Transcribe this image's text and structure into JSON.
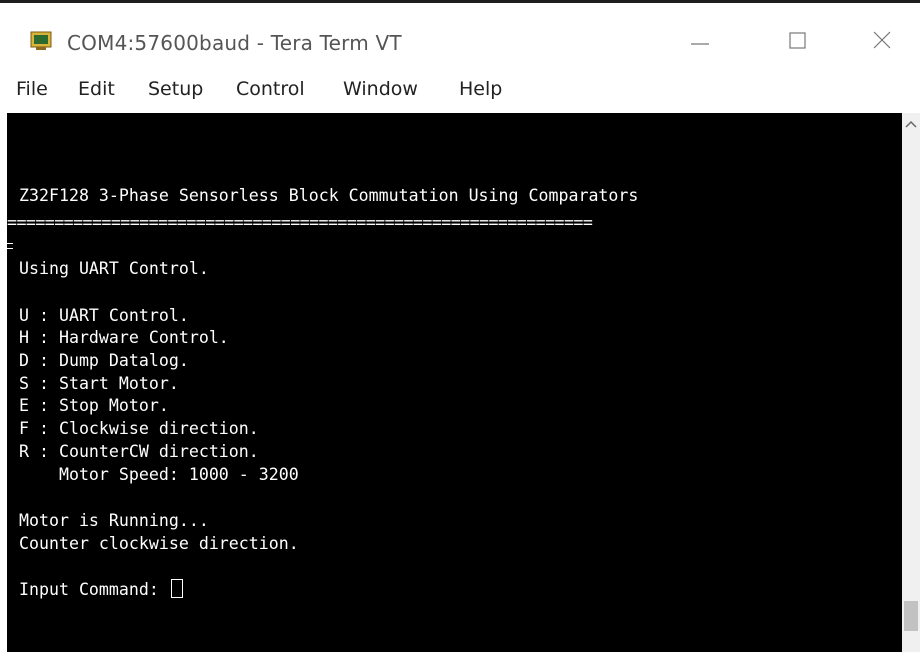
{
  "window": {
    "title": "COM4:57600baud - Tera Term VT"
  },
  "menu": {
    "items": [
      "File",
      "Edit",
      "Setup",
      "Control",
      "Window",
      "Help"
    ]
  },
  "terminal": {
    "header": "Z32F128 3-Phase Sensorless Block Commutation Using Comparators",
    "separator": "==============================================================",
    "mode": "Using UART Control.",
    "commands": [
      "U : UART Control.",
      "H : Hardware Control.",
      "D : Dump Datalog.",
      "S : Start Motor.",
      "E : Stop Motor.",
      "F : Clockwise direction.",
      "R : CounterCW direction.",
      "    Motor Speed: 1000 - 3200"
    ],
    "status1": "Motor is Running...",
    "status2": "Counter clockwise direction.",
    "prompt": "Input Command: "
  },
  "colors": {
    "terminal_bg": "#000000",
    "terminal_fg": "#ffffff"
  }
}
